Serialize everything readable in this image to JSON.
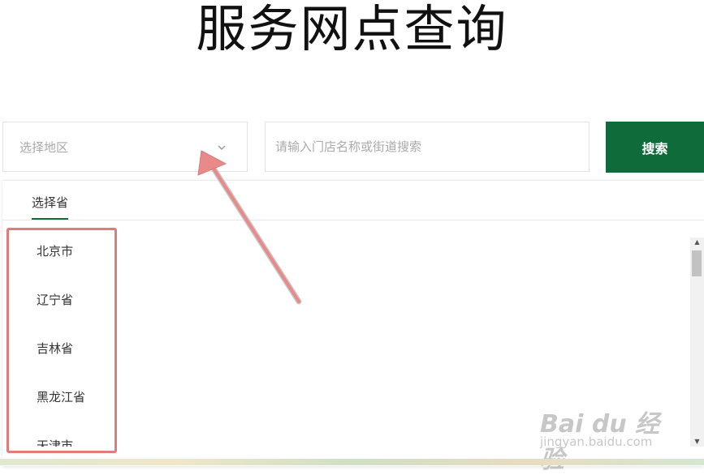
{
  "header": {
    "title": "服务网点查询"
  },
  "search": {
    "region_placeholder": "选择地区",
    "keyword_placeholder": "请输入门店名称或街道搜索",
    "submit_label": "搜索"
  },
  "dropdown": {
    "tabs": [
      {
        "label": "选择省",
        "active": true
      }
    ],
    "provinces": [
      {
        "label": "北京市"
      },
      {
        "label": "辽宁省"
      },
      {
        "label": "吉林省"
      },
      {
        "label": "黑龙江省"
      },
      {
        "label": "天津市"
      }
    ]
  },
  "annotation": {
    "arrow_color": "#e88a8a",
    "highlight_color": "#e07b7b"
  },
  "watermark": {
    "logo_text": "Bai du 经验",
    "url": "jingyan.baidu.com"
  },
  "colors": {
    "accent": "#0f6b3a"
  }
}
